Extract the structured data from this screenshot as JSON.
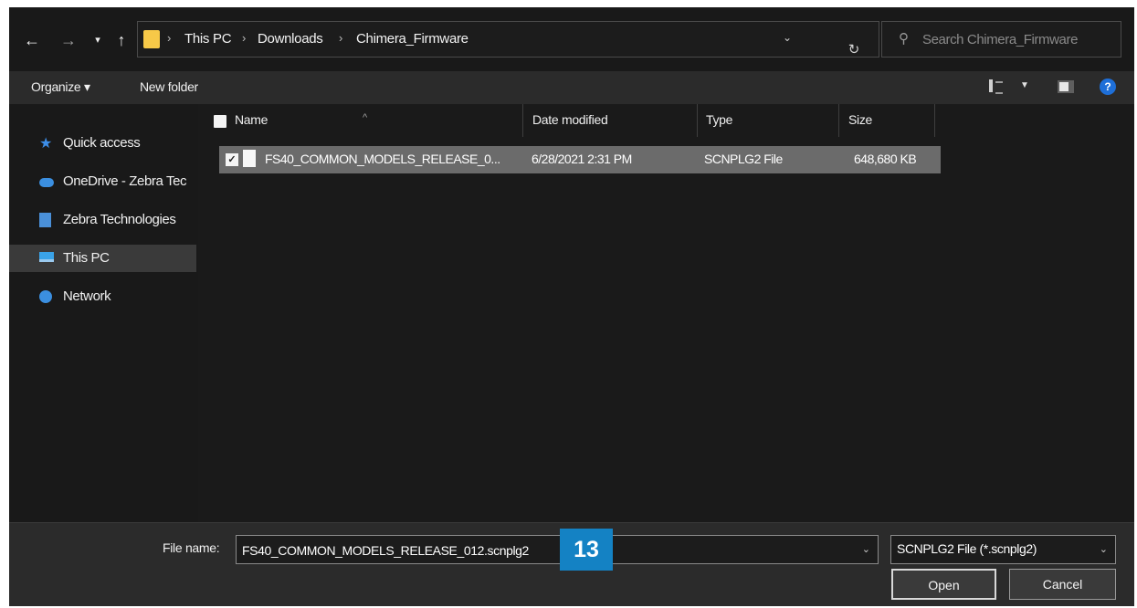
{
  "address": {
    "breadcrumbs": [
      "This PC",
      "Downloads",
      "Chimera_Firmware"
    ],
    "search_placeholder": "Search Chimera_Firmware"
  },
  "toolbar": {
    "organize_label": "Organize ▾",
    "new_folder_label": "New folder",
    "help_label": "?"
  },
  "sidebar": {
    "items": [
      {
        "label": "Quick access",
        "icon": "star-icon"
      },
      {
        "label": "OneDrive - Zebra Tec",
        "icon": "cloud-icon"
      },
      {
        "label": "Zebra Technologies",
        "icon": "building-icon"
      },
      {
        "label": "This PC",
        "icon": "computer-icon",
        "active": true
      },
      {
        "label": "Network",
        "icon": "network-icon"
      }
    ]
  },
  "list": {
    "columns": [
      "Name",
      "Date modified",
      "Type",
      "Size"
    ],
    "rows": [
      {
        "name": "FS40_COMMON_MODELS_RELEASE_0...",
        "date": "6/28/2021 2:31 PM",
        "type": "SCNPLG2 File",
        "size": "648,680 KB",
        "selected": true
      }
    ]
  },
  "bottom": {
    "file_name_label": "File name:",
    "file_name_value": "FS40_COMMON_MODELS_RELEASE_012.scnplg2",
    "file_type_value": "SCNPLG2 File (*.scnplg2)",
    "open_label": "Open",
    "cancel_label": "Cancel",
    "step_badge": "13"
  },
  "colors": {
    "accent_badge": "#1482c4",
    "folder": "#f7c948",
    "help": "#1e6fd8",
    "selection": "#6b6b6b"
  }
}
